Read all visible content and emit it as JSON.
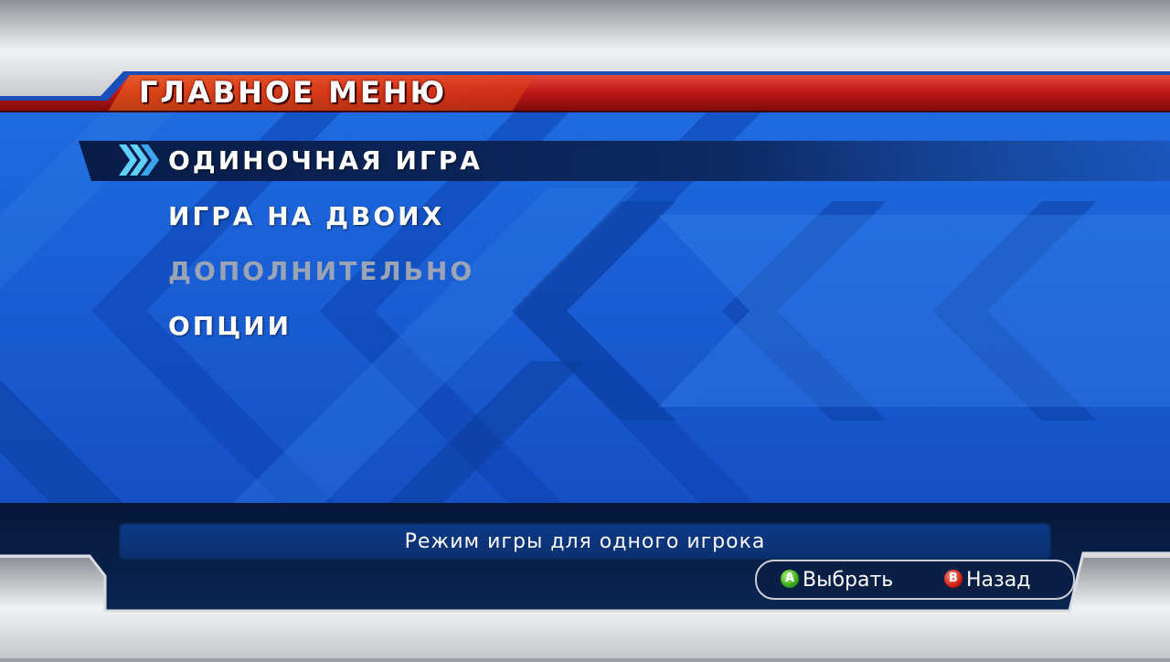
{
  "header": {
    "title": "ГЛАВНОЕ МЕНЮ"
  },
  "menu": {
    "selected_index": 0,
    "items": [
      {
        "label": "ОДИНОЧНАЯ ИГРА",
        "enabled": true
      },
      {
        "label": "ИГРА НА ДВОИХ",
        "enabled": true
      },
      {
        "label": "ДОПОЛНИТЕЛЬНО",
        "enabled": false
      },
      {
        "label": "ОПЦИИ",
        "enabled": true
      }
    ]
  },
  "description": "Режим игры для одного игрока",
  "buttons": {
    "select": {
      "glyph": "A",
      "label": "Выбрать"
    },
    "back": {
      "glyph": "B",
      "label": "Назад"
    }
  },
  "icons": {
    "selector": "chevron-right-icon",
    "select": "a-button-icon",
    "back": "b-button-icon"
  },
  "colors": {
    "panel_blue": "#1a5fd6",
    "header_red": "#c01818",
    "selection_navy": "#0d2a63",
    "footer_navy": "#071c40",
    "disabled_text": "#9aa4b5"
  }
}
